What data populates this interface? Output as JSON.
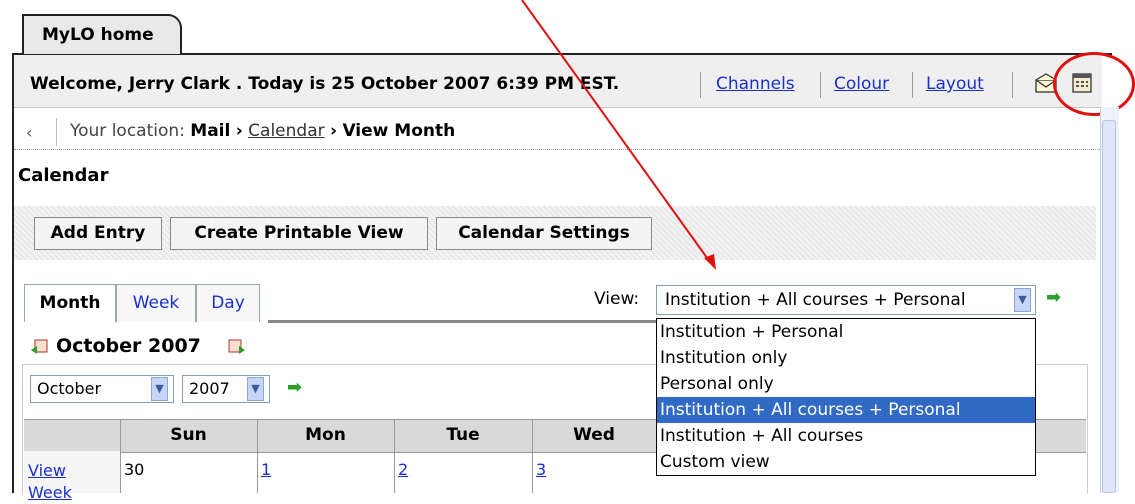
{
  "tab": {
    "label": "MyLO home"
  },
  "welcome": {
    "text": "Welcome, Jerry Clark . Today is 25 October 2007 6:39 PM EST.",
    "links": [
      "Channels",
      "Colour",
      "Layout"
    ]
  },
  "icons": {
    "mail": "mail-icon",
    "calendar": "calendar-icon"
  },
  "location": {
    "back": "‹",
    "label": "Your location:",
    "crumb1": "Mail",
    "crumb2": "Calendar",
    "crumb3": "View Month",
    "arrow": "›"
  },
  "page_title": "Calendar",
  "toolbar": {
    "add_entry": "Add Entry",
    "printable": "Create Printable View",
    "settings": "Calendar Settings"
  },
  "view_tabs": [
    "Month",
    "Week",
    "Day"
  ],
  "view_filter": {
    "label": "View:",
    "selected": "Institution + All courses + Personal",
    "options": [
      "Institution + Personal",
      "Institution only",
      "Personal only",
      "Institution + All courses + Personal",
      "Institution + All courses",
      "Custom view"
    ]
  },
  "month_header": "October 2007",
  "selectors": {
    "month": "October",
    "year": "2007"
  },
  "calendar": {
    "days": [
      "Sun",
      "Mon",
      "Tue",
      "Wed"
    ],
    "row": {
      "view_week": "View Week",
      "dates": [
        "30",
        "1",
        "2",
        "3"
      ]
    }
  },
  "colors": {
    "link": "#1a2fcc",
    "annotation": "#e01010",
    "selected": "#316ac5"
  }
}
